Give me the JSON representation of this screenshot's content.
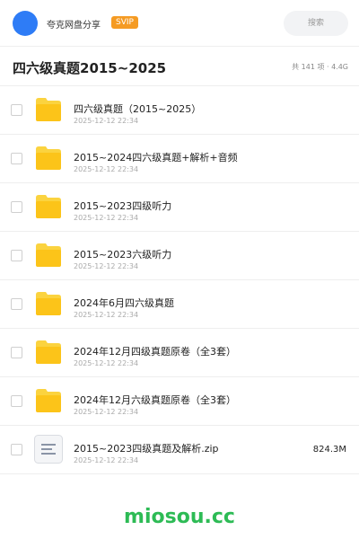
{
  "header": {
    "user_name": "夸克网盘分享",
    "badge": "SVIP",
    "search_placeholder": "搜索"
  },
  "title_bar": {
    "title": "四六级真题2015~2025",
    "summary": "共 141 项 · 4.4G"
  },
  "files": [
    {
      "name": "四六级真题（2015~2025）",
      "date": "2025-12-12 22:34",
      "type": "folder",
      "icon": "folder-icon",
      "size": ""
    },
    {
      "name": "2015~2024四六级真题+解析+音频",
      "date": "2025-12-12 22:34",
      "type": "folder",
      "icon": "folder-icon",
      "size": ""
    },
    {
      "name": "2015~2023四级听力",
      "date": "2025-12-12 22:34",
      "type": "folder",
      "icon": "folder-icon",
      "size": ""
    },
    {
      "name": "2015~2023六级听力",
      "date": "2025-12-12 22:34",
      "type": "folder",
      "icon": "folder-icon",
      "size": ""
    },
    {
      "name": "2024年6月四六级真题",
      "date": "2025-12-12 22:34",
      "type": "folder",
      "icon": "folder-icon",
      "size": ""
    },
    {
      "name": "2024年12月四级真题原卷（全3套）",
      "date": "2025-12-12 22:34",
      "type": "folder",
      "icon": "folder-icon",
      "size": ""
    },
    {
      "name": "2024年12月六级真题原卷（全3套）",
      "date": "2025-12-12 22:34",
      "type": "folder",
      "icon": "folder-icon",
      "size": ""
    },
    {
      "name": "2015~2023四级真题及解析.zip",
      "date": "2025-12-12 22:34",
      "type": "file",
      "icon": "file-icon",
      "size": "824.3M"
    }
  ],
  "watermark": "miosou.cc",
  "colors": {
    "avatar": "#2e7cf6",
    "badge": "#f59b23",
    "folder": "#fbd33f",
    "watermark": "#2dbb55"
  }
}
